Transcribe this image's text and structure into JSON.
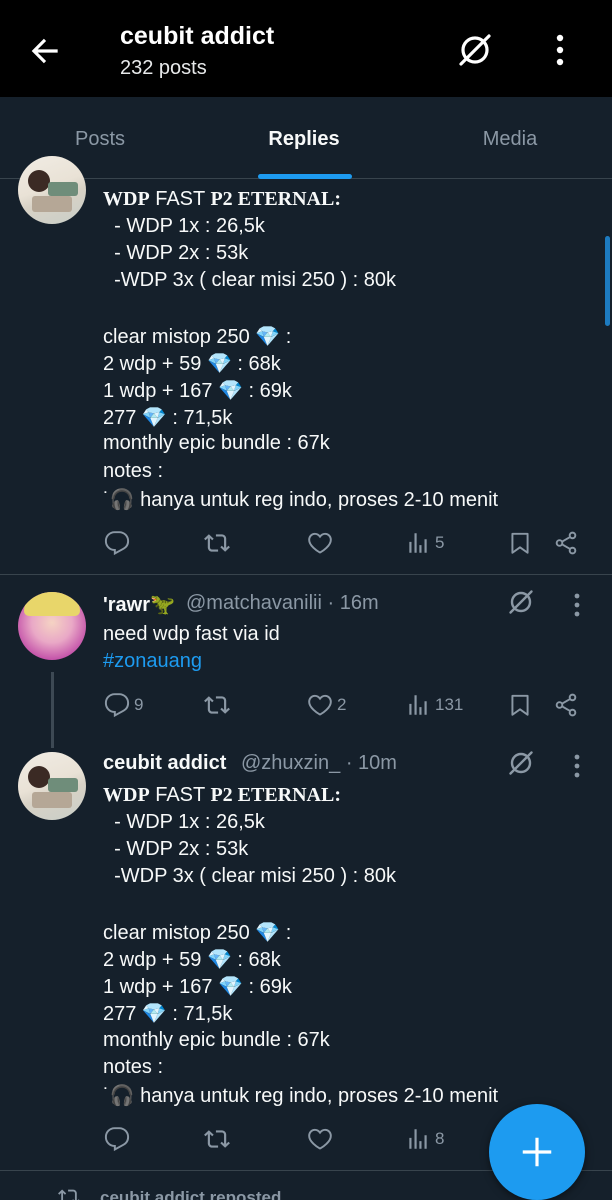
{
  "header": {
    "title": "ceubit addict",
    "subtitle": "232 posts"
  },
  "tabs": [
    {
      "label": "Posts",
      "active": false
    },
    {
      "label": "Replies",
      "active": true
    },
    {
      "label": "Media",
      "active": false
    }
  ],
  "posts": [
    {
      "truncated_top": true,
      "lines": [
        "WDP FAST P2 ETERNAL:",
        "  - WDP 1x : 26,5k",
        "  - WDP 2x : 53k",
        "  -WDP 3x ( clear misi 250 ) : 80k",
        "",
        "clear mistop 250 💎 :",
        "2 wdp + 59 💎 : 68k",
        "1 wdp + 167 💎 : 69k",
        "277 💎 : 71,5k",
        "monthly epic bundle : 67k",
        "notes :",
        "˙🎧 hanya untuk reg indo, proses 2-10 menit"
      ],
      "stats": {
        "replies": "",
        "reposts": "",
        "likes": "",
        "views": "5"
      }
    },
    {
      "name": "'rawr🦖",
      "handle": "@matchavanilii",
      "time": "· 16m",
      "lines": [
        "need wdp fast via id",
        "#zonauang"
      ],
      "stats": {
        "replies": "9",
        "reposts": "",
        "likes": "2",
        "views": "131"
      }
    },
    {
      "name": "ceubit addict",
      "handle": "@zhuxzin_",
      "time": "· 10m",
      "lines": [
        "WDP FAST P2 ETERNAL:",
        "  - WDP 1x : 26,5k",
        "  - WDP 2x : 53k",
        "  -WDP 3x ( clear misi 250 ) : 80k",
        "",
        "clear mistop 250 💎 :",
        "2 wdp + 59 💎 : 68k",
        "1 wdp + 167 💎 : 69k",
        "277 💎 : 71,5k",
        "monthly epic bundle : 67k",
        "notes :",
        "˙🎧 hanya untuk reg indo, proses 2-10 menit"
      ],
      "stats": {
        "replies": "",
        "reposts": "",
        "likes": "",
        "views": "8"
      }
    }
  ],
  "post0_title": {
    "a": "WDP",
    "b": " FAST ",
    "c": "P2 ETERNAL:"
  },
  "post2_title": {
    "a": "WDP",
    "b": " FAST ",
    "c": "P2 ETERNAL:"
  },
  "repost_indicator": "ceubit addict reposted",
  "colors": {
    "background": "#15202b",
    "topbar": "#000000",
    "accent": "#1d9bf0",
    "muted": "#8b98a5",
    "divider": "#38444d"
  },
  "icons": {
    "back": "arrow-left-icon",
    "grok": "grok-icon",
    "more": "more-vertical-icon",
    "reply": "reply-icon",
    "repost": "repost-icon",
    "like": "heart-icon",
    "views": "views-icon",
    "bookmark": "bookmark-icon",
    "share": "share-icon",
    "compose": "plus-icon"
  }
}
